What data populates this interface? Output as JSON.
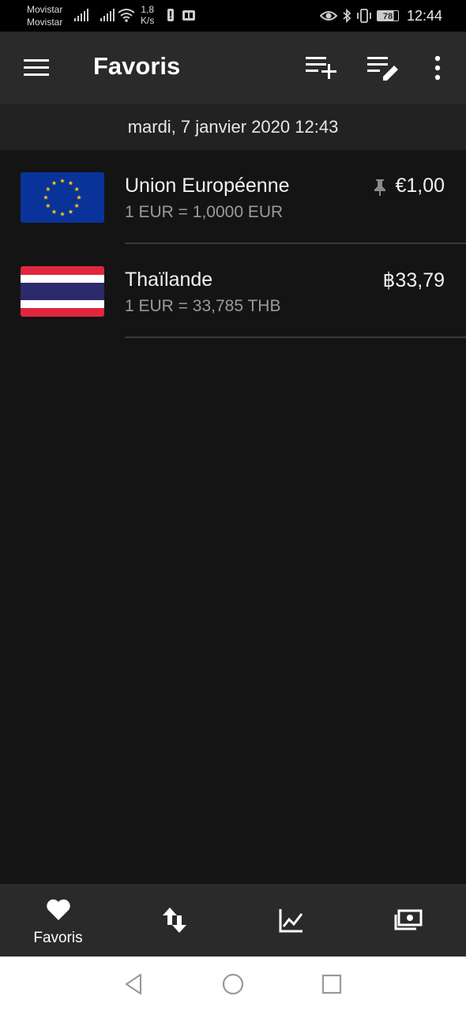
{
  "status_bar": {
    "carrier1": "Movistar",
    "carrier2": "Movistar",
    "speed_value": "1,8",
    "speed_unit": "K/s",
    "battery": "78",
    "time": "12:44"
  },
  "app_bar": {
    "title": "Favoris",
    "icons": [
      "menu-icon",
      "playlist-add-icon",
      "playlist-edit-icon",
      "more-vert-icon"
    ]
  },
  "date_line": "mardi, 7 janvier 2020 12:43",
  "favorites": [
    {
      "country": "Union Européenne",
      "rate": "1 EUR = 1,0000 EUR",
      "value": "€1,00",
      "pinned": true,
      "flag": "eu-flag"
    },
    {
      "country": "Thaïlande",
      "rate": "1 EUR = 33,785 THB",
      "value": "฿33,79",
      "pinned": false,
      "flag": "thailand-flag"
    }
  ],
  "bottom_nav": {
    "items": [
      {
        "label": "Favoris",
        "icon": "heart-icon",
        "active": true
      },
      {
        "label": "",
        "icon": "swap-vertical-icon"
      },
      {
        "label": "",
        "icon": "chart-line-icon"
      },
      {
        "label": "",
        "icon": "cash-icon"
      }
    ]
  },
  "colors": {
    "background": "#141414",
    "app_bar": "#2a2a2a",
    "date_bar": "#222222",
    "secondary_text": "#9a9a9a"
  }
}
